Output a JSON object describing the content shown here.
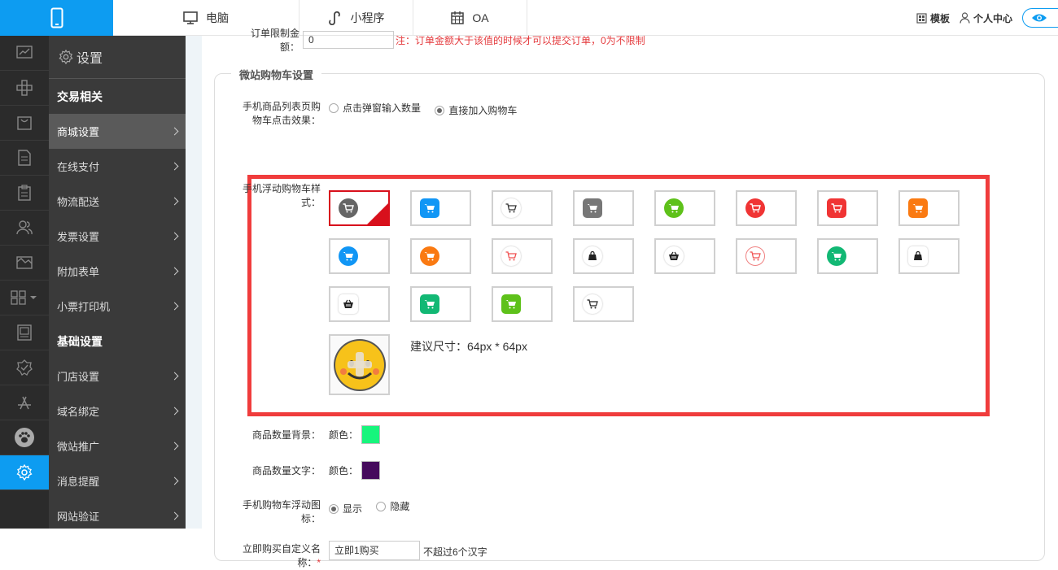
{
  "top_tabs": [
    {
      "label": "电脑",
      "icon": "monitor-icon"
    },
    {
      "label": "小程序",
      "icon": "miniprogram-icon"
    },
    {
      "label": "OA",
      "icon": "calendar-icon"
    }
  ],
  "top_right": {
    "template_label": "模板",
    "user_center_label": "个人中心",
    "preview_icon": "eye-icon"
  },
  "icon_bar": [
    "chart-icon",
    "settings-icon",
    "bag-icon",
    "document-icon",
    "clipboard-icon",
    "users-icon",
    "image-icon",
    "grid-icon",
    "layout-icon",
    "badge-check-icon",
    "app-store-icon",
    "paw-icon",
    "gear-icon"
  ],
  "sidebar": {
    "title": "设置",
    "group1": "交易相关",
    "items1": [
      "商城设置",
      "在线支付",
      "物流配送",
      "发票设置",
      "附加表单",
      "小票打印机"
    ],
    "group2": "基础设置",
    "items2": [
      "门店设置",
      "域名绑定",
      "微站推广",
      "消息提醒",
      "网站验证"
    ]
  },
  "form": {
    "top_row_label": "订单限制金额：",
    "top_row_value": "0",
    "top_row_note": "注：订单金额大于该值的时候才可以提交订单，0为不限制",
    "section_title": "微站购物车设置",
    "click_effect": {
      "label_line1": "手机商品列表页购",
      "label_line2": "物车点击效果：",
      "options": [
        "点击弹窗输入数量",
        "直接加入购物车"
      ],
      "selected_index": 1
    },
    "float_style": {
      "label_line1": "手机浮动购物车样",
      "label_line2": "式：",
      "size_hint": "建议尺寸：64px * 64px"
    },
    "count_bg": {
      "label": "商品数量背景：",
      "color_label": "颜色：",
      "color": "#17f57c"
    },
    "count_text": {
      "label": "商品数量文字：",
      "color_label": "颜色：",
      "color": "#450a5c"
    },
    "float_icon": {
      "label_line1": "手机购物车浮动图",
      "label_line2": "标：",
      "options": [
        "显示",
        "隐藏"
      ],
      "selected_index": 0
    },
    "buy_now": {
      "label_line1": "立即购买自定义名",
      "label_line2": "称：",
      "required_mark": "*",
      "value": "立即1购买",
      "hint": "不超过6个汉字"
    }
  },
  "colors": {
    "accent": "#0d9cf1",
    "highlight_border": "#f03c3c",
    "sidebar_bg": "#3a3a3a",
    "iconbar_bg": "#2b2b2b"
  }
}
